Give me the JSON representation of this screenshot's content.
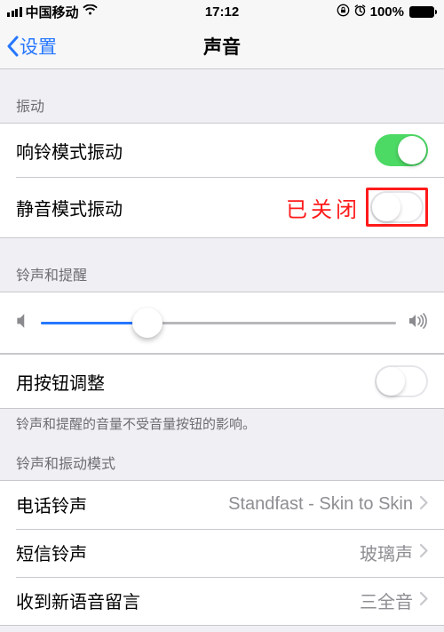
{
  "status": {
    "carrier": "中国移动",
    "time": "17:12",
    "battery_pct": "100%"
  },
  "nav": {
    "back": "设置",
    "title": "声音"
  },
  "sections": {
    "vibration_header": "振动",
    "ringer_header": "铃声和提醒",
    "ringer_footer": "铃声和提醒的音量不受音量按钮的影响。",
    "patterns_header": "铃声和振动模式"
  },
  "rows": {
    "vibrate_ring": {
      "label": "响铃模式振动",
      "on": true
    },
    "vibrate_silent": {
      "label": "静音模式振动",
      "on": false,
      "annotation": "已关闭"
    },
    "change_with_buttons": {
      "label": "用按钮调整",
      "on": false
    },
    "ringtone": {
      "label": "电话铃声",
      "value": "Standfast - Skin to Skin"
    },
    "text_tone": {
      "label": "短信铃声",
      "value": "玻璃声"
    },
    "voicemail": {
      "label": "收到新语音留言",
      "value": "三全音"
    }
  },
  "slider": {
    "value": 0.3
  }
}
